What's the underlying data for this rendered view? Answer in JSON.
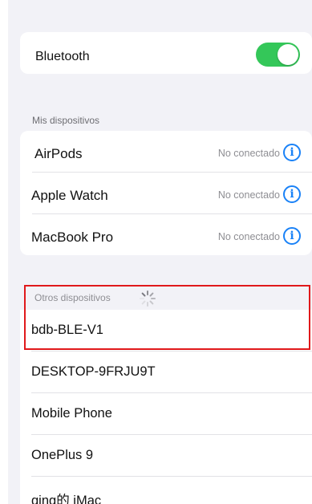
{
  "bluetooth": {
    "label": "Bluetooth",
    "enabled": true,
    "toggle_color": "#34c759"
  },
  "my_devices": {
    "header": "Mis dispositivos",
    "items": [
      {
        "name": "AirPods",
        "status": "No conectado",
        "icon": "info-icon"
      },
      {
        "name": "Apple Watch",
        "status": "No conectado",
        "icon": "info-icon"
      },
      {
        "name": "MacBook Pro",
        "status": "No conectado",
        "icon": "info-icon"
      }
    ]
  },
  "other_devices": {
    "header": "Otros dispositivos",
    "loading_icon": "spinner-icon",
    "items": [
      {
        "name": "bdb-BLE-V1"
      },
      {
        "name": "DESKTOP-9FRJU9T"
      },
      {
        "name": "Mobile Phone"
      },
      {
        "name": "OnePlus 9"
      },
      {
        "name": "qing的 iMac"
      }
    ]
  },
  "colors": {
    "accent": "#1a82f7",
    "highlight": "#e0191b",
    "background": "#f2f2f7"
  }
}
